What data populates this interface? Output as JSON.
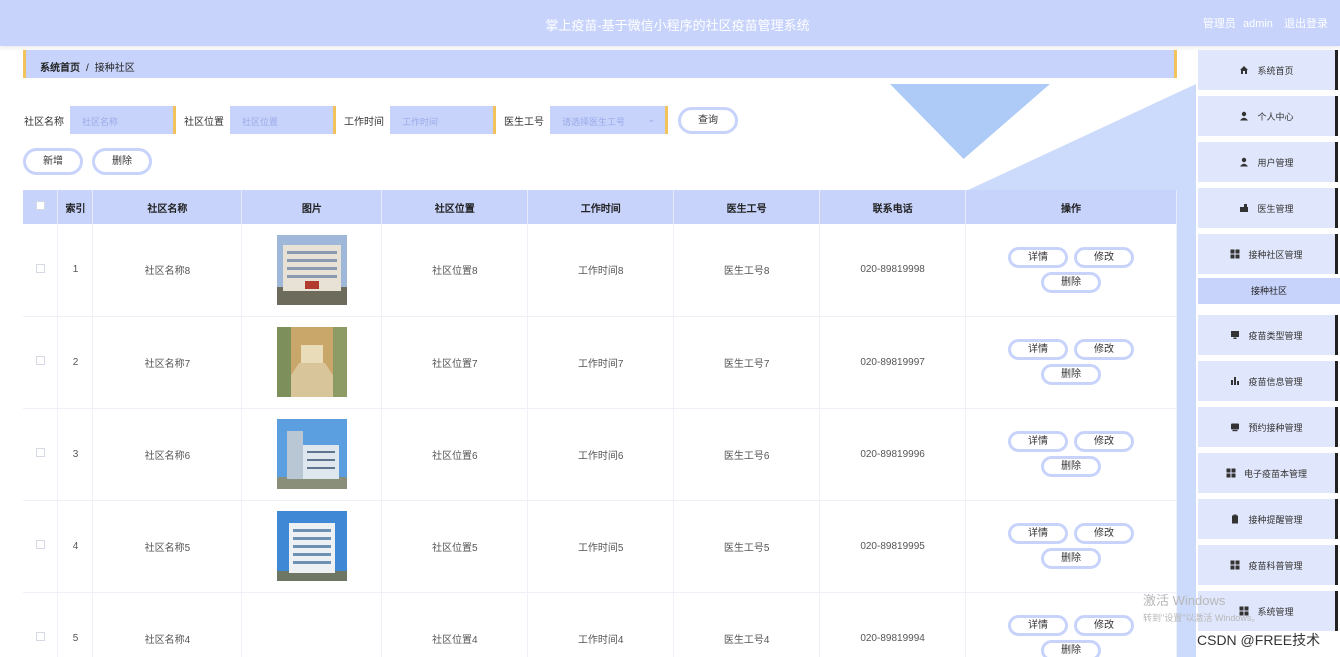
{
  "header": {
    "title": "掌上疫苗-基于微信小程序的社区疫苗管理系统",
    "role": "管理员",
    "username": "admin",
    "logout": "退出登录"
  },
  "breadcrumb": {
    "home": "系统首页",
    "separator": "/",
    "current": "接种社区"
  },
  "search": {
    "name_label": "社区名称",
    "name_placeholder": "社区名称",
    "location_label": "社区位置",
    "location_placeholder": "社区位置",
    "time_label": "工作时间",
    "time_placeholder": "工作时间",
    "doctor_label": "医生工号",
    "doctor_placeholder": "请选择医生工号",
    "query_button": "查询"
  },
  "actions": {
    "add": "新增",
    "delete": "删除"
  },
  "table": {
    "columns": [
      "索引",
      "社区名称",
      "图片",
      "社区位置",
      "工作时间",
      "医生工号",
      "联系电话",
      "操作"
    ],
    "row_actions": {
      "detail": "详情",
      "edit": "修改",
      "delete": "删除"
    },
    "rows": [
      {
        "index": "1",
        "name": "社区名称8",
        "location": "社区位置8",
        "time": "工作时间8",
        "doctor": "医生工号8",
        "phone": "020-89819998",
        "image": "hospital-building"
      },
      {
        "index": "2",
        "name": "社区名称7",
        "location": "社区位置7",
        "time": "工作时间7",
        "doctor": "医生工号7",
        "phone": "020-89819997",
        "image": "hospital-corridor"
      },
      {
        "index": "3",
        "name": "社区名称6",
        "location": "社区位置6",
        "time": "工作时间6",
        "doctor": "医生工号6",
        "phone": "020-89819996",
        "image": "office-tower"
      },
      {
        "index": "4",
        "name": "社区名称5",
        "location": "社区位置5",
        "time": "工作时间5",
        "doctor": "医生工号5",
        "phone": "020-89819995",
        "image": "office-building"
      },
      {
        "index": "5",
        "name": "社区名称4",
        "location": "社区位置4",
        "time": "工作时间4",
        "doctor": "医生工号4",
        "phone": "020-89819994",
        "image": ""
      }
    ]
  },
  "sidebar": {
    "items": [
      {
        "label": "系统首页",
        "icon": "home-icon"
      },
      {
        "label": "个人中心",
        "icon": "user-icon"
      },
      {
        "label": "用户管理",
        "icon": "user-icon"
      },
      {
        "label": "医生管理",
        "icon": "doctor-icon"
      },
      {
        "label": "接种社区管理",
        "icon": "grid-icon"
      },
      {
        "label": "疫苗类型管理",
        "icon": "monitor-icon"
      },
      {
        "label": "疫苗信息管理",
        "icon": "bar-chart-icon"
      },
      {
        "label": "预约接种管理",
        "icon": "calendar-icon"
      },
      {
        "label": "电子疫苗本管理",
        "icon": "grid-icon"
      },
      {
        "label": "接种提醒管理",
        "icon": "clipboard-icon"
      },
      {
        "label": "疫苗科普管理",
        "icon": "grid-icon"
      },
      {
        "label": "系统管理",
        "icon": "grid-icon"
      }
    ],
    "active_sub": "接种社区"
  },
  "watermark": {
    "line1": "激活 Windows",
    "line2": "转到\"设置\"以激活 Windows。",
    "csdn": "CSDN @FREE技术"
  },
  "colors": {
    "accent": "#c7d3fb",
    "highlight": "#f3c35b",
    "header_text": "#ffffff"
  }
}
